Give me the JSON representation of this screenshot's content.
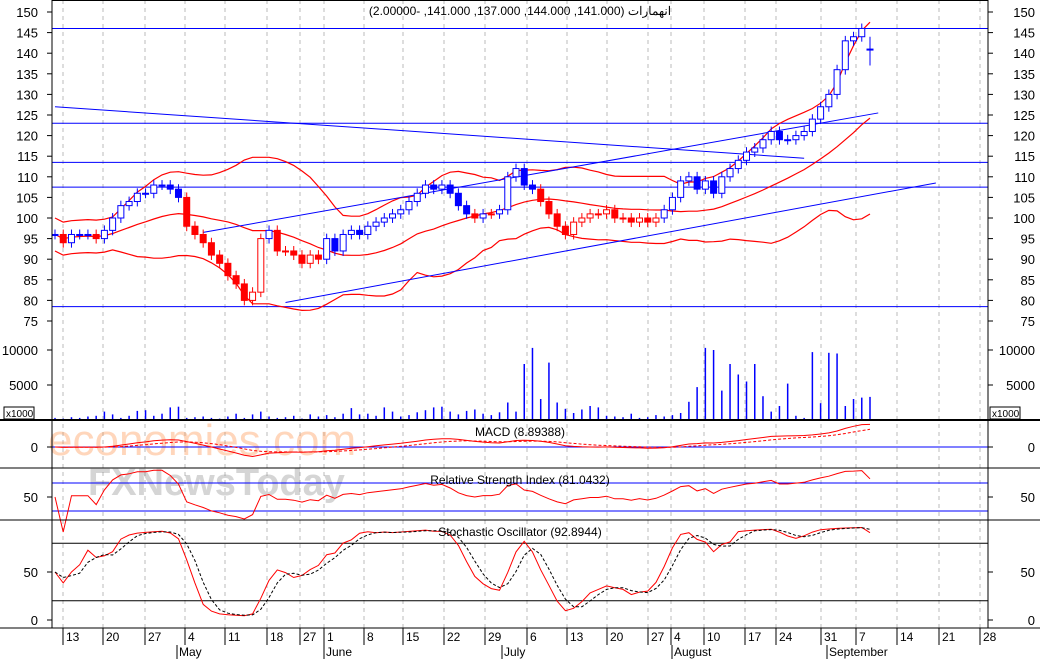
{
  "chart_data": {
    "type": "candlestick",
    "title": "انهمارات (141.000, 144.000, 137.000, 141.000, -2.00000)",
    "symbol": "انهمارات",
    "last_ohlc_text": "(141.000, 144.000, 137.000, 141.000, -2.00000)",
    "last_bar": {
      "open": 141,
      "high": 144,
      "low": 137,
      "close": 141,
      "change": -2
    },
    "price_axis": {
      "ylim": [
        75,
        150
      ],
      "ticks": [
        150,
        145,
        140,
        135,
        130,
        125,
        120,
        115,
        110,
        105,
        100,
        95,
        90,
        85,
        80,
        75
      ]
    },
    "closes": [
      96,
      94,
      96,
      96,
      96,
      95,
      97,
      100,
      103,
      104,
      106,
      106,
      108,
      108,
      107,
      105,
      98,
      96,
      94,
      91,
      89,
      86,
      84,
      80,
      82,
      95,
      97,
      92,
      92,
      91,
      89,
      91,
      90,
      95,
      92,
      96,
      97,
      96,
      98,
      99,
      100,
      101,
      102,
      104,
      106,
      108,
      107,
      108,
      106,
      103,
      101,
      100,
      101,
      101,
      102,
      110,
      112,
      108,
      107,
      104,
      101,
      98,
      96,
      99,
      100,
      101,
      101,
      102,
      100,
      100,
      99,
      100,
      99,
      100,
      102,
      105,
      109,
      110,
      107,
      109,
      106,
      110,
      112,
      114,
      116,
      117,
      119,
      121,
      119,
      119,
      120,
      121,
      124,
      127,
      130,
      136,
      143,
      144,
      146,
      141
    ],
    "horizontal_lines": [
      146,
      123,
      113.5,
      107.5,
      78.5
    ],
    "trendlines": [
      {
        "from": [
          0,
          127
        ],
        "to": [
          91,
          114.5
        ]
      },
      {
        "from": [
          28,
          79.5
        ],
        "to": [
          107,
          108.5
        ]
      },
      {
        "from": [
          18,
          96.5
        ],
        "to": [
          100,
          125.5
        ]
      }
    ],
    "volume": {
      "label": "x1000",
      "ticks": [
        10000,
        5000
      ],
      "values": [
        300,
        200,
        400,
        300,
        500,
        600,
        1200,
        800,
        300,
        600,
        1300,
        1400,
        600,
        900,
        1800,
        1900,
        300,
        400,
        500,
        300,
        200,
        500,
        900,
        300,
        800,
        1200,
        500,
        300,
        400,
        600,
        200,
        800,
        500,
        700,
        400,
        900,
        1700,
        800,
        900,
        600,
        1800,
        1200,
        500,
        700,
        1100,
        1400,
        1800,
        1900,
        1200,
        800,
        1300,
        1500,
        900,
        700,
        1100,
        2500,
        1200,
        8000,
        10300,
        3000,
        8200,
        2500,
        1600,
        1000,
        1500,
        2000,
        1800,
        600,
        500,
        400,
        900,
        300,
        400,
        700,
        500,
        700,
        1000,
        2600,
        4700,
        10300,
        10000,
        4200,
        8000,
        6500,
        5500,
        8000,
        3400,
        1200,
        2000,
        5200,
        600,
        300,
        9700,
        2400,
        9600,
        9500,
        2000,
        3000,
        3200,
        3300
      ]
    },
    "indicators": [
      {
        "name": "MACD",
        "label": "MACD (8.89388)",
        "value": 8.89388,
        "ticks": [
          0
        ]
      },
      {
        "name": "RSI",
        "label": "Relative Strength Index (81.0432)",
        "value": 81.0432,
        "levels": [
          70,
          30
        ],
        "ticks": [
          50
        ]
      },
      {
        "name": "Stochastic",
        "label": "Stochastic Oscillator (92.8944)",
        "value": 92.8944,
        "levels": [
          80,
          20
        ],
        "ticks": [
          50,
          0
        ]
      }
    ],
    "x_day_ticks": [
      "13",
      "20",
      "27",
      "4",
      "11",
      "18",
      "27",
      "1",
      "8",
      "15",
      "22",
      "29",
      "6",
      "13",
      "20",
      "27",
      "4",
      "10",
      "17",
      "24",
      "31",
      "7",
      "14",
      "21",
      "28"
    ],
    "x_month_labels": [
      "May",
      "June",
      "July",
      "August",
      "September"
    ]
  },
  "watermark": {
    "line1": "economies.com",
    "line2": "FXNewsToday"
  }
}
